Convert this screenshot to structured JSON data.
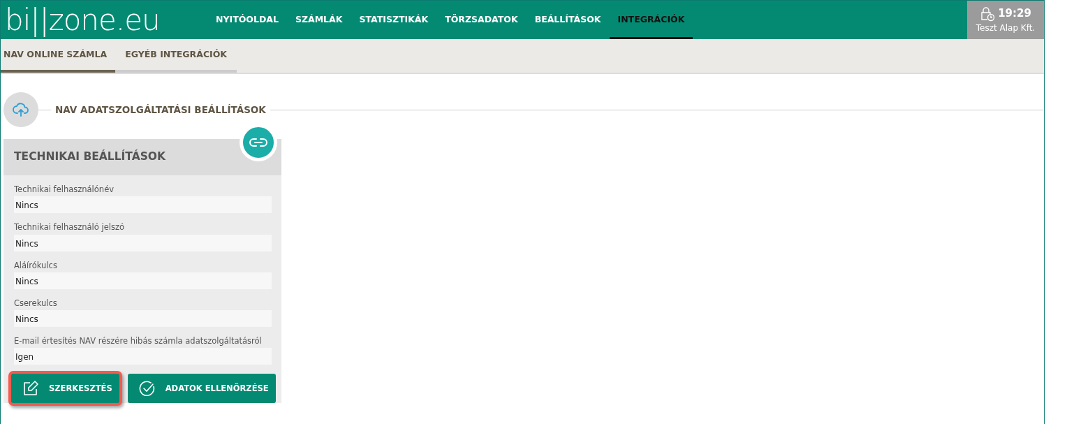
{
  "logo": "bi||zone.eu",
  "nav": [
    {
      "label": "NYITÓOLDAL",
      "selected": false
    },
    {
      "label": "SZÁMLÁK",
      "selected": false
    },
    {
      "label": "STATISZTIKÁK",
      "selected": false
    },
    {
      "label": "TÖRZSADATOK",
      "selected": false
    },
    {
      "label": "BEÁLLÍTÁSOK",
      "selected": false
    },
    {
      "label": "INTEGRÁCIÓK",
      "selected": true
    }
  ],
  "session": {
    "time": "19:29",
    "company": "Teszt Alap Kft."
  },
  "subtabs": [
    {
      "label": "NAV ONLINE SZÁMLA",
      "selected": true
    },
    {
      "label": "EGYÉB INTEGRÁCIÓK",
      "selected": false
    }
  ],
  "section_title": "NAV ADATSZOLGÁLTATÁSI BEÁLLÍTÁSOK",
  "card": {
    "title": "TECHNIKAI BEÁLLÍTÁSOK",
    "fields": [
      {
        "label": "Technikai felhasználónév",
        "value": "Nincs"
      },
      {
        "label": "Technikai felhasználó jelszó",
        "value": "Nincs"
      },
      {
        "label": "Aláírókulcs",
        "value": "Nincs"
      },
      {
        "label": "Cserekulcs",
        "value": "Nincs"
      },
      {
        "label": "E-mail értesítés NAV részére hibás számla adatszolgáltatásról",
        "value": "Igen"
      }
    ],
    "buttons": [
      {
        "kind": "edit",
        "label": "SZERKESZTÉS",
        "highlighted": true
      },
      {
        "kind": "check",
        "label": "ADATOK ELLENŐRZÉSE",
        "highlighted": false
      }
    ]
  }
}
